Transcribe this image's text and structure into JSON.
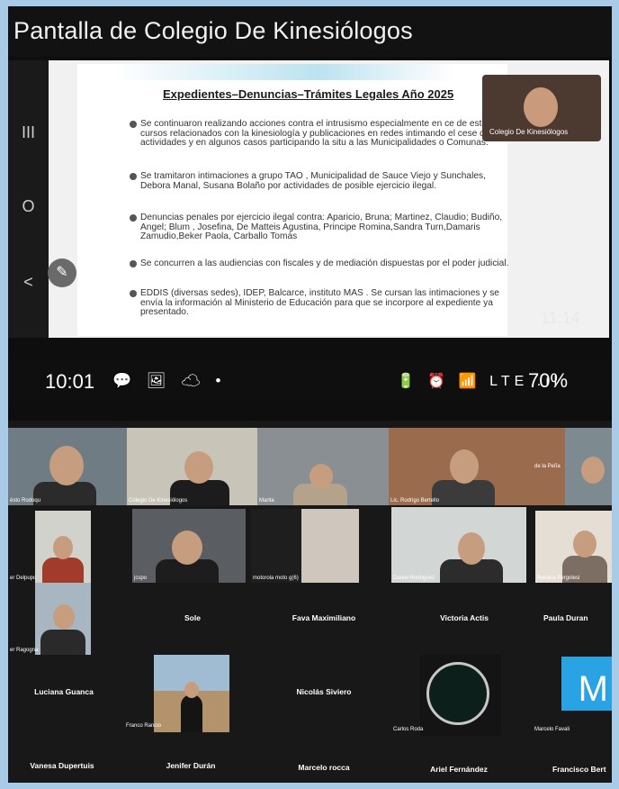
{
  "window": {
    "title": "Pantalla de Colegio De Kinesiólogos"
  },
  "slide": {
    "title": "Expedientes–Denuncias–Trámites Legales Año 2025",
    "bullets": [
      "Se continuaron realizando acciones contra el intrusismo especialmente en ce de estética, cursos relacionados con la kinesiología y publicaciones en redes intimando el cese de tales actividades y en algunos casos participando la situ a las Municipalidades o Comunas.",
      "Se tramitaron intimaciones a grupo TAO , Municipalidad de Sauce Viejo y Sunchales, Debora Manal, Susana Bolaño por actividades de posible ejercicio ilegal.",
      "Denuncias penales por ejercicio ilegal contra: Aparicio, Bruna; Martinez, Claudio; Budiño, Angel; Blum , Josefina, De Matteis Agustina, Principe Romina,Sandra Turn,Damaris Zamudio,Beker Paola, Carballo Tomás",
      "Se concurren a las audiencias con fiscales y de mediación dispuestas por el poder judicial.",
      "EDDIS (diversas sedes), IDEP, Balcarce, instituto MAS . Se cursan las intimaciones y se envía la información al Ministerio de Educación para que se incorpore al expediente ya presentado."
    ]
  },
  "presenter": {
    "label": "Colegio De Kinesiólogos"
  },
  "clock": "11:14",
  "status": {
    "time": "10:01",
    "battery": "70%",
    "left_icons": "💬 🖼 ☁ •",
    "right_icons": "🔋 ⏰ 📶 LTE .ıl"
  },
  "nav_icons": {
    "recents": "III",
    "home": "O",
    "back": "<",
    "edit": "✎"
  },
  "participants_video": [
    "ésto Rodoqu",
    "Colegio De Kinesiólogos",
    "Marita",
    "Lic. Rodrigo Bertello",
    "de la Peña",
    "er Delpupo",
    "jcspo",
    "motorola moto g(6)",
    "Daniel Rodriguez",
    "Rosana Pergolesi",
    "er Ragogna",
    "Franco Rancio",
    "Carlos Roda",
    "Marcelo Favali"
  ],
  "participants_name": {
    "sole": "Sole",
    "fava": "Fava Maximiliano",
    "victoria": "Victoria Actis",
    "paula": "Paula Duran",
    "luciana": "Luciana Guanca",
    "nicolas": "Nicolás Siviero",
    "vanesa": "Vanesa Dupertuis",
    "jenifer": "Jenifer Durán",
    "marcelo_r": "Marcelo rocca",
    "ariel": "Ariel Fernández",
    "francisco": "Francisco Bert"
  },
  "avatar_letter": "M",
  "colors": {
    "page_bg": "#a9cbe8",
    "grid_bg": "#181818",
    "avatar_blue": "#29a3e3",
    "logo_green": "#23c48f"
  }
}
